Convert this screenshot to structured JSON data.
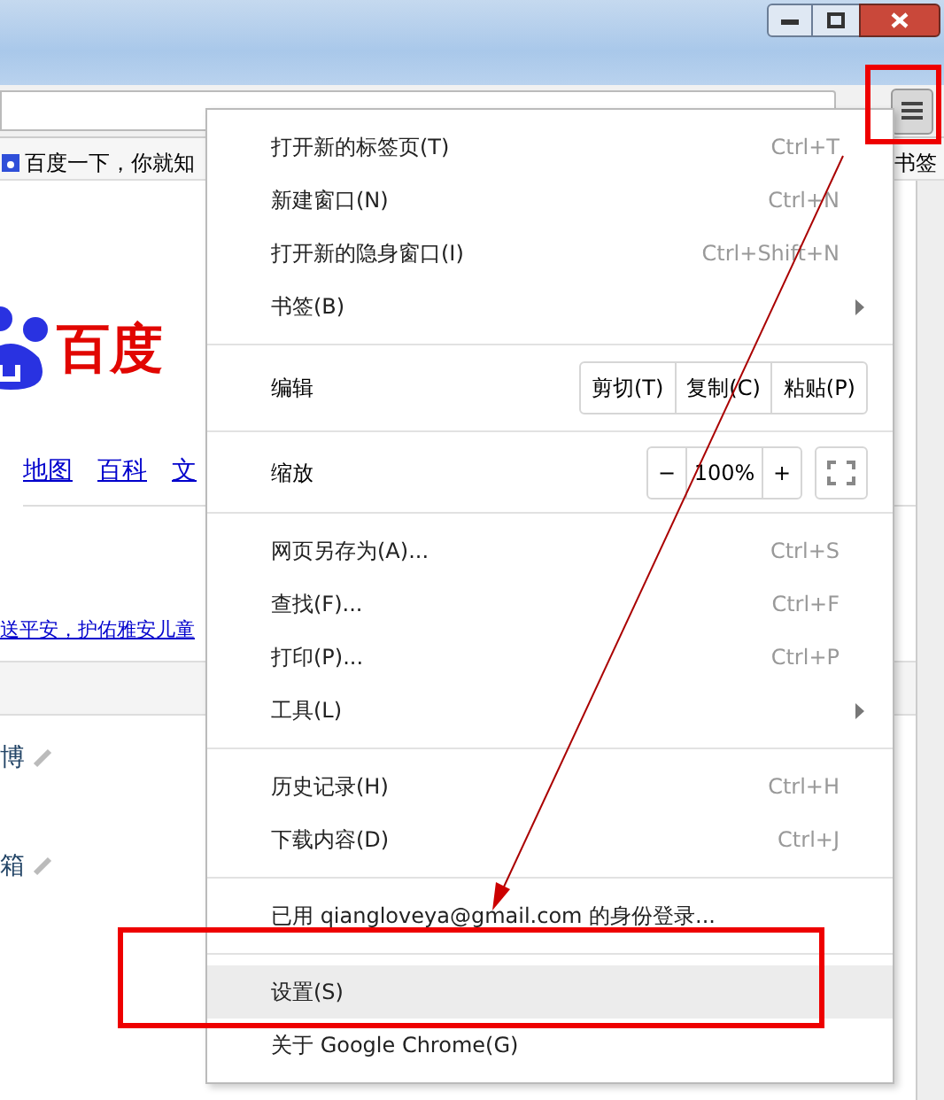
{
  "bookmarks_bar": {
    "items": [
      {
        "label": "百度一下，你就知"
      }
    ],
    "right_label": "书签"
  },
  "page": {
    "logo_text": "百度",
    "nav_links": [
      "地图",
      "百科",
      "文"
    ],
    "news_link": "送平安，护佑雅安儿童",
    "list_items": [
      "博",
      "箱"
    ]
  },
  "menu": {
    "groups": [
      [
        {
          "kind": "item",
          "label": "打开新的标签页(T)",
          "shortcut": "Ctrl+T",
          "submenu": false,
          "selected": false
        },
        {
          "kind": "item",
          "label": "新建窗口(N)",
          "shortcut": "Ctrl+N",
          "submenu": false,
          "selected": false
        },
        {
          "kind": "item",
          "label": "打开新的隐身窗口(I)",
          "shortcut": "Ctrl+Shift+N",
          "submenu": false,
          "selected": false
        },
        {
          "kind": "item",
          "label": "书签(B)",
          "submenu": true,
          "selected": false
        }
      ],
      [
        {
          "kind": "edit",
          "label": "编辑",
          "buttons": [
            "剪切(T)",
            "复制(C)",
            "粘贴(P)"
          ]
        }
      ],
      [
        {
          "kind": "zoom",
          "label": "缩放",
          "minus": "−",
          "value": "100%",
          "plus": "+"
        }
      ],
      [
        {
          "kind": "item",
          "label": "网页另存为(A)...",
          "shortcut": "Ctrl+S",
          "submenu": false,
          "selected": false
        },
        {
          "kind": "item",
          "label": "查找(F)...",
          "shortcut": "Ctrl+F",
          "submenu": false,
          "selected": false
        },
        {
          "kind": "item",
          "label": "打印(P)...",
          "shortcut": "Ctrl+P",
          "submenu": false,
          "selected": false
        },
        {
          "kind": "item",
          "label": "工具(L)",
          "submenu": true,
          "selected": false
        }
      ],
      [
        {
          "kind": "item",
          "label": "历史记录(H)",
          "shortcut": "Ctrl+H",
          "submenu": false,
          "selected": false
        },
        {
          "kind": "item",
          "label": "下载内容(D)",
          "shortcut": "Ctrl+J",
          "submenu": false,
          "selected": false
        }
      ],
      [
        {
          "kind": "item",
          "label": "已用 qiangloveya@gmail.com 的身份登录...",
          "submenu": false,
          "selected": false
        }
      ],
      [
        {
          "kind": "item",
          "label": "设置(S)",
          "submenu": false,
          "selected": true
        },
        {
          "kind": "item",
          "label": "关于 Google Chrome(G)",
          "submenu": false,
          "selected": false
        }
      ]
    ]
  }
}
